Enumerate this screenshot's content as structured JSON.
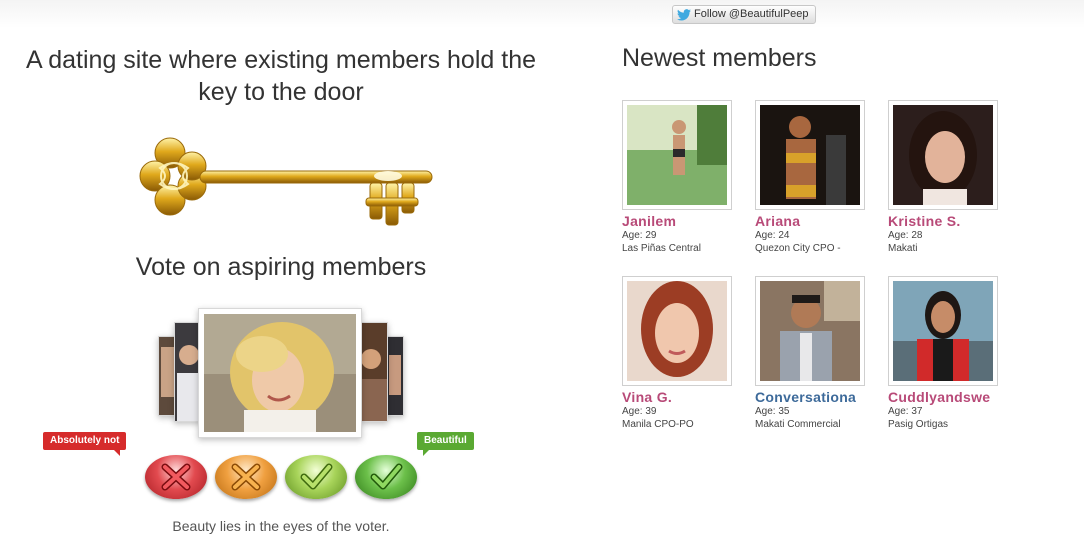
{
  "twitter": {
    "label": "Follow @BeautifulPeep",
    "icon": "twitter-bird-icon"
  },
  "hero": {
    "headline": "A dating site where existing members hold the key to the door",
    "key_image": "golden-key-icon"
  },
  "vote": {
    "title": "Vote on aspiring members",
    "tag_negative": "Absolutely not",
    "tag_positive": "Beautiful",
    "buttons": [
      {
        "name": "vote-absolutely-not-button",
        "icon": "x-icon",
        "color": "#d9373c"
      },
      {
        "name": "vote-no-button",
        "icon": "x-icon",
        "color": "#e8862b"
      },
      {
        "name": "vote-yes-button",
        "icon": "check-icon",
        "color": "#8cbf3a"
      },
      {
        "name": "vote-beautiful-button",
        "icon": "check-icon",
        "color": "#4fa936"
      }
    ],
    "caption": "Beauty lies in the eyes of the voter."
  },
  "newest": {
    "title": "Newest members",
    "members": [
      {
        "name": "Janilem",
        "age": "Age: 29",
        "location": "Las Piñas Central"
      },
      {
        "name": "Ariana",
        "age": "Age: 24",
        "location": "Quezon City CPO -"
      },
      {
        "name": "Kristine S.",
        "age": "Age: 28",
        "location": "Makati"
      },
      {
        "name": "Vina G.",
        "age": "Age: 39",
        "location": "Manila CPO-PO"
      },
      {
        "name": "Conversationa",
        "age": "Age: 35",
        "location": "Makati Commercial"
      },
      {
        "name": "Cuddlyandswe",
        "age": "Age: 37",
        "location": "Pasig Ortigas"
      }
    ]
  },
  "colors": {
    "name_pink": "#b84a78",
    "name_blue": "#3d6a9a",
    "tag_red": "#d62b2b",
    "tag_green": "#5aa932"
  }
}
